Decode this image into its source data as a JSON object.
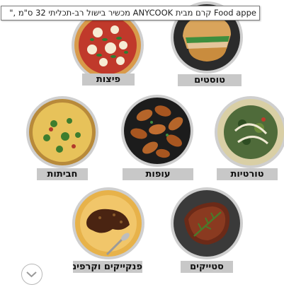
{
  "tooltip": {
    "text": "Food appe קרם מבית ANYCOOK מכשיר בישול רב-תכליתי 32 ס\"מ ,\""
  },
  "categories": [
    {
      "label": "פיצות",
      "icon": "pizza-image"
    },
    {
      "label": "טוסטים",
      "icon": "toast-sandwich-image"
    },
    {
      "label": "חביתות",
      "icon": "omelette-image"
    },
    {
      "label": "עופות",
      "icon": "chicken-wings-image"
    },
    {
      "label": "טורטיות",
      "icon": "tortilla-image"
    },
    {
      "label": "פנקייקים וקרפים",
      "icon": "pancake-crepe-image"
    },
    {
      "label": "סטייקים",
      "icon": "steak-image"
    }
  ],
  "scroll": {
    "icon": "chevron-down-icon"
  }
}
